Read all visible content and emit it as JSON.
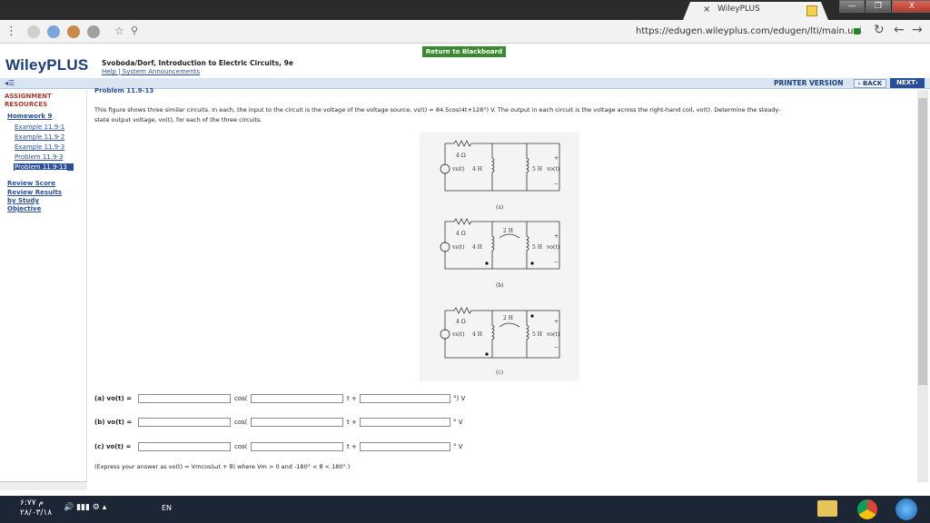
{
  "browser": {
    "tab_close": "×",
    "tab_title": "WileyPLUS",
    "url": "https://edugen.wileyplus.com/edugen/lti/main.uni",
    "win_min": "—",
    "win_max": "❐",
    "win_close": "X"
  },
  "header": {
    "return_blackboard": "Return to Blackboard",
    "logo": "WileyPLUS",
    "book_title": "Svoboda/Dorf, Introduction to Electric Circuits, 9e",
    "help_links": "Help | System Announcements"
  },
  "navbar": {
    "printer_version": "PRINTER VERSION",
    "back": "‹ BACK",
    "next": "NEXT›"
  },
  "sidebar": {
    "heading": "ASSIGNMENT RESOURCES",
    "homework": "Homework 9",
    "items": [
      "Example 11.9-1",
      "Example 11.9-2",
      "Example 11.9-3",
      "Problem 11.9-3",
      "Problem 11.9-13"
    ],
    "review_score": "Review Score",
    "review_results": "Review Results",
    "by_study_objective": "by Study Objective"
  },
  "problem": {
    "title": "Problem 11.9-13",
    "text_line1": "This figure shows three similar circuits. In each, the input to the circuit is the voltage of the voltage source, vs(t) = 84.5cos(4t+128°) V. The output in each circuit is the voltage across the right-hand coil, vo(t). Determine the steady-",
    "text_line2": "state output voltage, vo(t), for each of the three circuits."
  },
  "figure": {
    "resistor": "4 Ω",
    "coil_left": "4 H",
    "coil_right": "5 H",
    "coil_mid": "2 H",
    "vs": "vs(t)",
    "vo": "vo(t)",
    "plus": "+",
    "minus": "−",
    "caption_a": "(a)",
    "caption_b": "(b)",
    "caption_c": "(c)"
  },
  "answers": [
    {
      "label": "(a) vo(t) =",
      "cos": "cos(",
      "t_plus": "t +",
      "unit": "°) V"
    },
    {
      "label": "(b) vo(t) =",
      "cos": "cos(",
      "t_plus": "t +",
      "unit": "° V"
    },
    {
      "label": "(c) vo(t) =",
      "cos": "cos(",
      "t_plus": "t +",
      "unit": "° V"
    }
  ],
  "express_note": "(Express your answer as vo(t) = Vmcos(ωt + θ) where Vm > 0 and -180° < θ < 180°.)",
  "taskbar": {
    "time": "۶:۷۷ م",
    "date": "۲۸/۰۳/۱۸",
    "lang": "EN"
  }
}
